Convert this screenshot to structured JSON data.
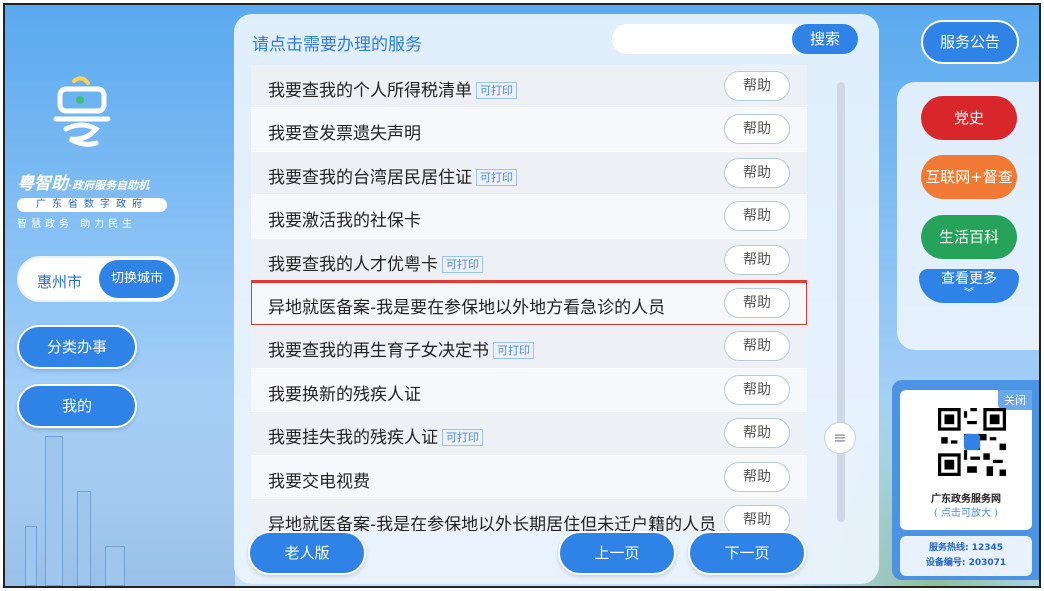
{
  "brand": {
    "name": "粤智助",
    "name_suffix": "·政府服务自助机",
    "subtitle": "广东省数字政府",
    "slogan": "智慧政务  助力民生"
  },
  "city": {
    "current": "惠州市",
    "switch_label": "切换城市"
  },
  "sidebar": {
    "category_label": "分类办事",
    "mine_label": "我的"
  },
  "main": {
    "title": "请点击需要办理的服务",
    "search": {
      "placeholder": "",
      "button_label": "搜索"
    },
    "items": [
      {
        "label": "我要查我的个人所得税清单",
        "tag": "可打印",
        "help": "帮助"
      },
      {
        "label": "我要查发票遗失声明",
        "tag": "",
        "help": "帮助"
      },
      {
        "label": "我要查我的台湾居民居住证",
        "tag": "可打印",
        "help": "帮助"
      },
      {
        "label": "我要激活我的社保卡",
        "tag": "",
        "help": "帮助"
      },
      {
        "label": "我要查我的人才优粤卡",
        "tag": "可打印",
        "help": "帮助"
      },
      {
        "label": "异地就医备案-我是要在参保地以外地方看急诊的人员",
        "tag": "",
        "help": "帮助",
        "highlighted": true
      },
      {
        "label": "我要查我的再生育子女决定书",
        "tag": "可打印",
        "help": "帮助"
      },
      {
        "label": "我要换新的残疾人证",
        "tag": "",
        "help": "帮助"
      },
      {
        "label": "我要挂失我的残疾人证",
        "tag": "可打印",
        "help": "帮助"
      },
      {
        "label": "我要交电视费",
        "tag": "",
        "help": "帮助"
      },
      {
        "label": "异地就医备案-我是在参保地以外长期居住但未迁户籍的人员",
        "tag": "",
        "help": "帮助"
      }
    ],
    "elderly_label": "老人版",
    "prev_label": "上一页",
    "next_label": "下一页"
  },
  "right": {
    "notice_label": "服务公告",
    "party_history_label": "党史",
    "internet_supervision_label": "互联网+督查",
    "life_encyclopedia_label": "生活百科",
    "more_label": "查看更多"
  },
  "qr": {
    "close_label": "关闭",
    "title": "广东政务服务网",
    "hint": "( 点击可放大 )",
    "hotline": "服务热线: 12345",
    "device_id": "设备编号: 203071"
  },
  "colors": {
    "accent": "#2f83e6",
    "party": "#d8262a",
    "supervision": "#f07a33",
    "life": "#26a35a",
    "highlight_border": "#e23a2e"
  }
}
